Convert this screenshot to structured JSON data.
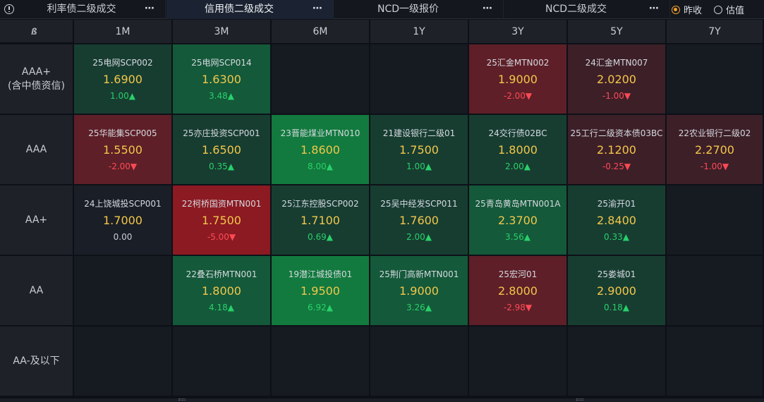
{
  "tabs": [
    {
      "label": "利率债二级成交",
      "more": "⋯",
      "active": false
    },
    {
      "label": "信用债二级成交",
      "more": "⋯",
      "active": true
    },
    {
      "label": "NCD一级报价",
      "more": "⋯",
      "active": false
    },
    {
      "label": "NCD二级成交",
      "more": "⋯",
      "active": false
    }
  ],
  "radio_options": [
    {
      "label": "昨收",
      "selected": true
    },
    {
      "label": "估值",
      "selected": false
    }
  ],
  "corner_logo": "ß",
  "columns": [
    "1M",
    "3M",
    "6M",
    "1Y",
    "3Y",
    "5Y",
    "7Y"
  ],
  "rows": [
    {
      "label_lines": [
        "AAA+",
        "(含中债资信)"
      ],
      "cells": [
        {
          "name": "25电网SCP002",
          "price": "1.6900",
          "change": "1.00▲",
          "dir": "up"
        },
        {
          "name": "25电网SCP014",
          "price": "1.6300",
          "change": "3.48▲",
          "dir": "up"
        },
        null,
        null,
        {
          "name": "25汇金MTN002",
          "price": "1.9000",
          "change": "-2.00▼",
          "dir": "down"
        },
        {
          "name": "24汇金MTN007",
          "price": "2.0200",
          "change": "-1.00▼",
          "dir": "down"
        },
        null
      ]
    },
    {
      "label_lines": [
        "AAA"
      ],
      "cells": [
        {
          "name": "25华能集SCP005",
          "price": "1.5500",
          "change": "-2.00▼",
          "dir": "down"
        },
        {
          "name": "25亦庄投资SCP001",
          "price": "1.6500",
          "change": "0.35▲",
          "dir": "up"
        },
        {
          "name": "23晋能煤业MTN010",
          "price": "1.8600",
          "change": "8.00▲",
          "dir": "up"
        },
        {
          "name": "21建设银行二级01",
          "price": "1.7500",
          "change": "1.00▲",
          "dir": "up"
        },
        {
          "name": "24交行债02BC",
          "price": "1.8000",
          "change": "2.00▲",
          "dir": "up"
        },
        {
          "name": "25工行二级资本债03BC",
          "price": "2.1200",
          "change": "-0.25▼",
          "dir": "down"
        },
        {
          "name": "22农业银行二级02",
          "price": "2.2700",
          "change": "-1.00▼",
          "dir": "down"
        }
      ]
    },
    {
      "label_lines": [
        "AA+"
      ],
      "cells": [
        {
          "name": "24上饶城投SCP001",
          "price": "1.7000",
          "change": "0.00",
          "dir": "flat"
        },
        {
          "name": "22柯桥国资MTN001",
          "price": "1.7500",
          "change": "-5.00▼",
          "dir": "down"
        },
        {
          "name": "25江东控股SCP002",
          "price": "1.7100",
          "change": "0.69▲",
          "dir": "up"
        },
        {
          "name": "25吴中经发SCP011",
          "price": "1.7600",
          "change": "2.00▲",
          "dir": "up"
        },
        {
          "name": "25青岛黄岛MTN001A",
          "price": "2.3700",
          "change": "3.56▲",
          "dir": "up"
        },
        {
          "name": "25渝开01",
          "price": "2.8400",
          "change": "0.33▲",
          "dir": "up"
        },
        null
      ]
    },
    {
      "label_lines": [
        "AA"
      ],
      "cells": [
        null,
        {
          "name": "22叠石桥MTN001",
          "price": "1.8000",
          "change": "4.18▲",
          "dir": "up"
        },
        {
          "name": "19潜江城投债01",
          "price": "1.9500",
          "change": "6.92▲",
          "dir": "up"
        },
        {
          "name": "25荆门高新MTN001",
          "price": "1.9000",
          "change": "3.26▲",
          "dir": "up"
        },
        {
          "name": "25宏河01",
          "price": "2.8000",
          "change": "-2.98▼",
          "dir": "down"
        },
        {
          "name": "25娄城01",
          "price": "2.9000",
          "change": "0.18▲",
          "dir": "up"
        },
        null
      ]
    },
    {
      "label_lines": [
        "AA-及以下"
      ],
      "cells": [
        null,
        null,
        null,
        null,
        null,
        null,
        null
      ]
    }
  ]
}
